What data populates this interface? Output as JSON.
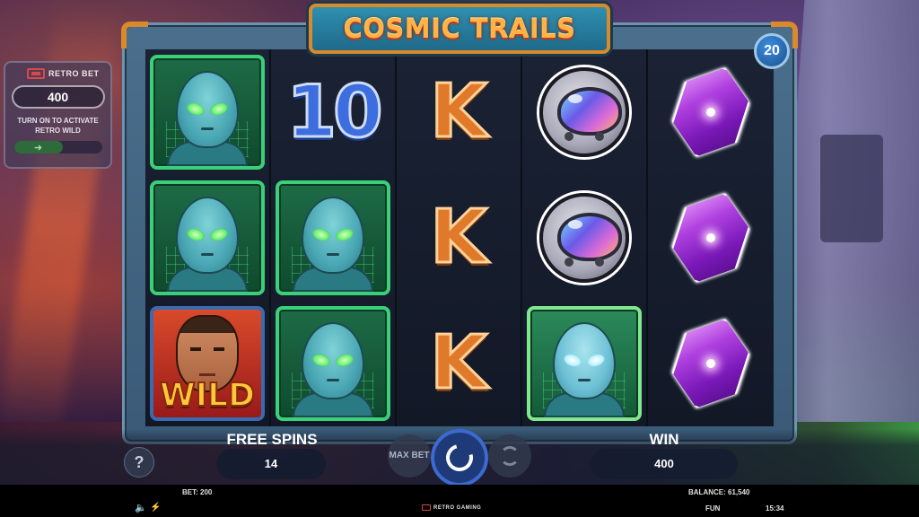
{
  "game": {
    "title": "COSMIC TRAILS",
    "free_spins_remaining_badge": "20"
  },
  "retro_bet": {
    "logo_text": "RETRO BET",
    "value": "400",
    "hint": "TURN ON TO ACTIVATE RETRO WILD",
    "toggle_icon": "arrow-right-icon"
  },
  "reels": [
    [
      "alien",
      "alien",
      "wild"
    ],
    [
      "10",
      "alien",
      "alien"
    ],
    [
      "K",
      "K",
      "K"
    ],
    [
      "helmet",
      "helmet",
      "alien-highlighted"
    ],
    [
      "gem",
      "gem",
      "gem"
    ]
  ],
  "symbols": {
    "ten": "10",
    "king": "K",
    "wild": "WILD"
  },
  "controls": {
    "help_label": "?",
    "free_spins_label": "FREE SPINS",
    "free_spins_value": "14",
    "win_label": "WIN",
    "win_value": "400",
    "max_bet_label": "MAX BET",
    "spin_icon": "spin-icon",
    "autoplay_icon": "autoplay-icon"
  },
  "status": {
    "bet": "BET: 200",
    "balance": "BALANCE: 61,540",
    "brand": "RETRO GAMING",
    "mode": "FUN",
    "time": "15:34"
  },
  "colors": {
    "title": "#ffb347",
    "frame_accent": "#d98a2a",
    "spin_button": "#1e3a78"
  }
}
